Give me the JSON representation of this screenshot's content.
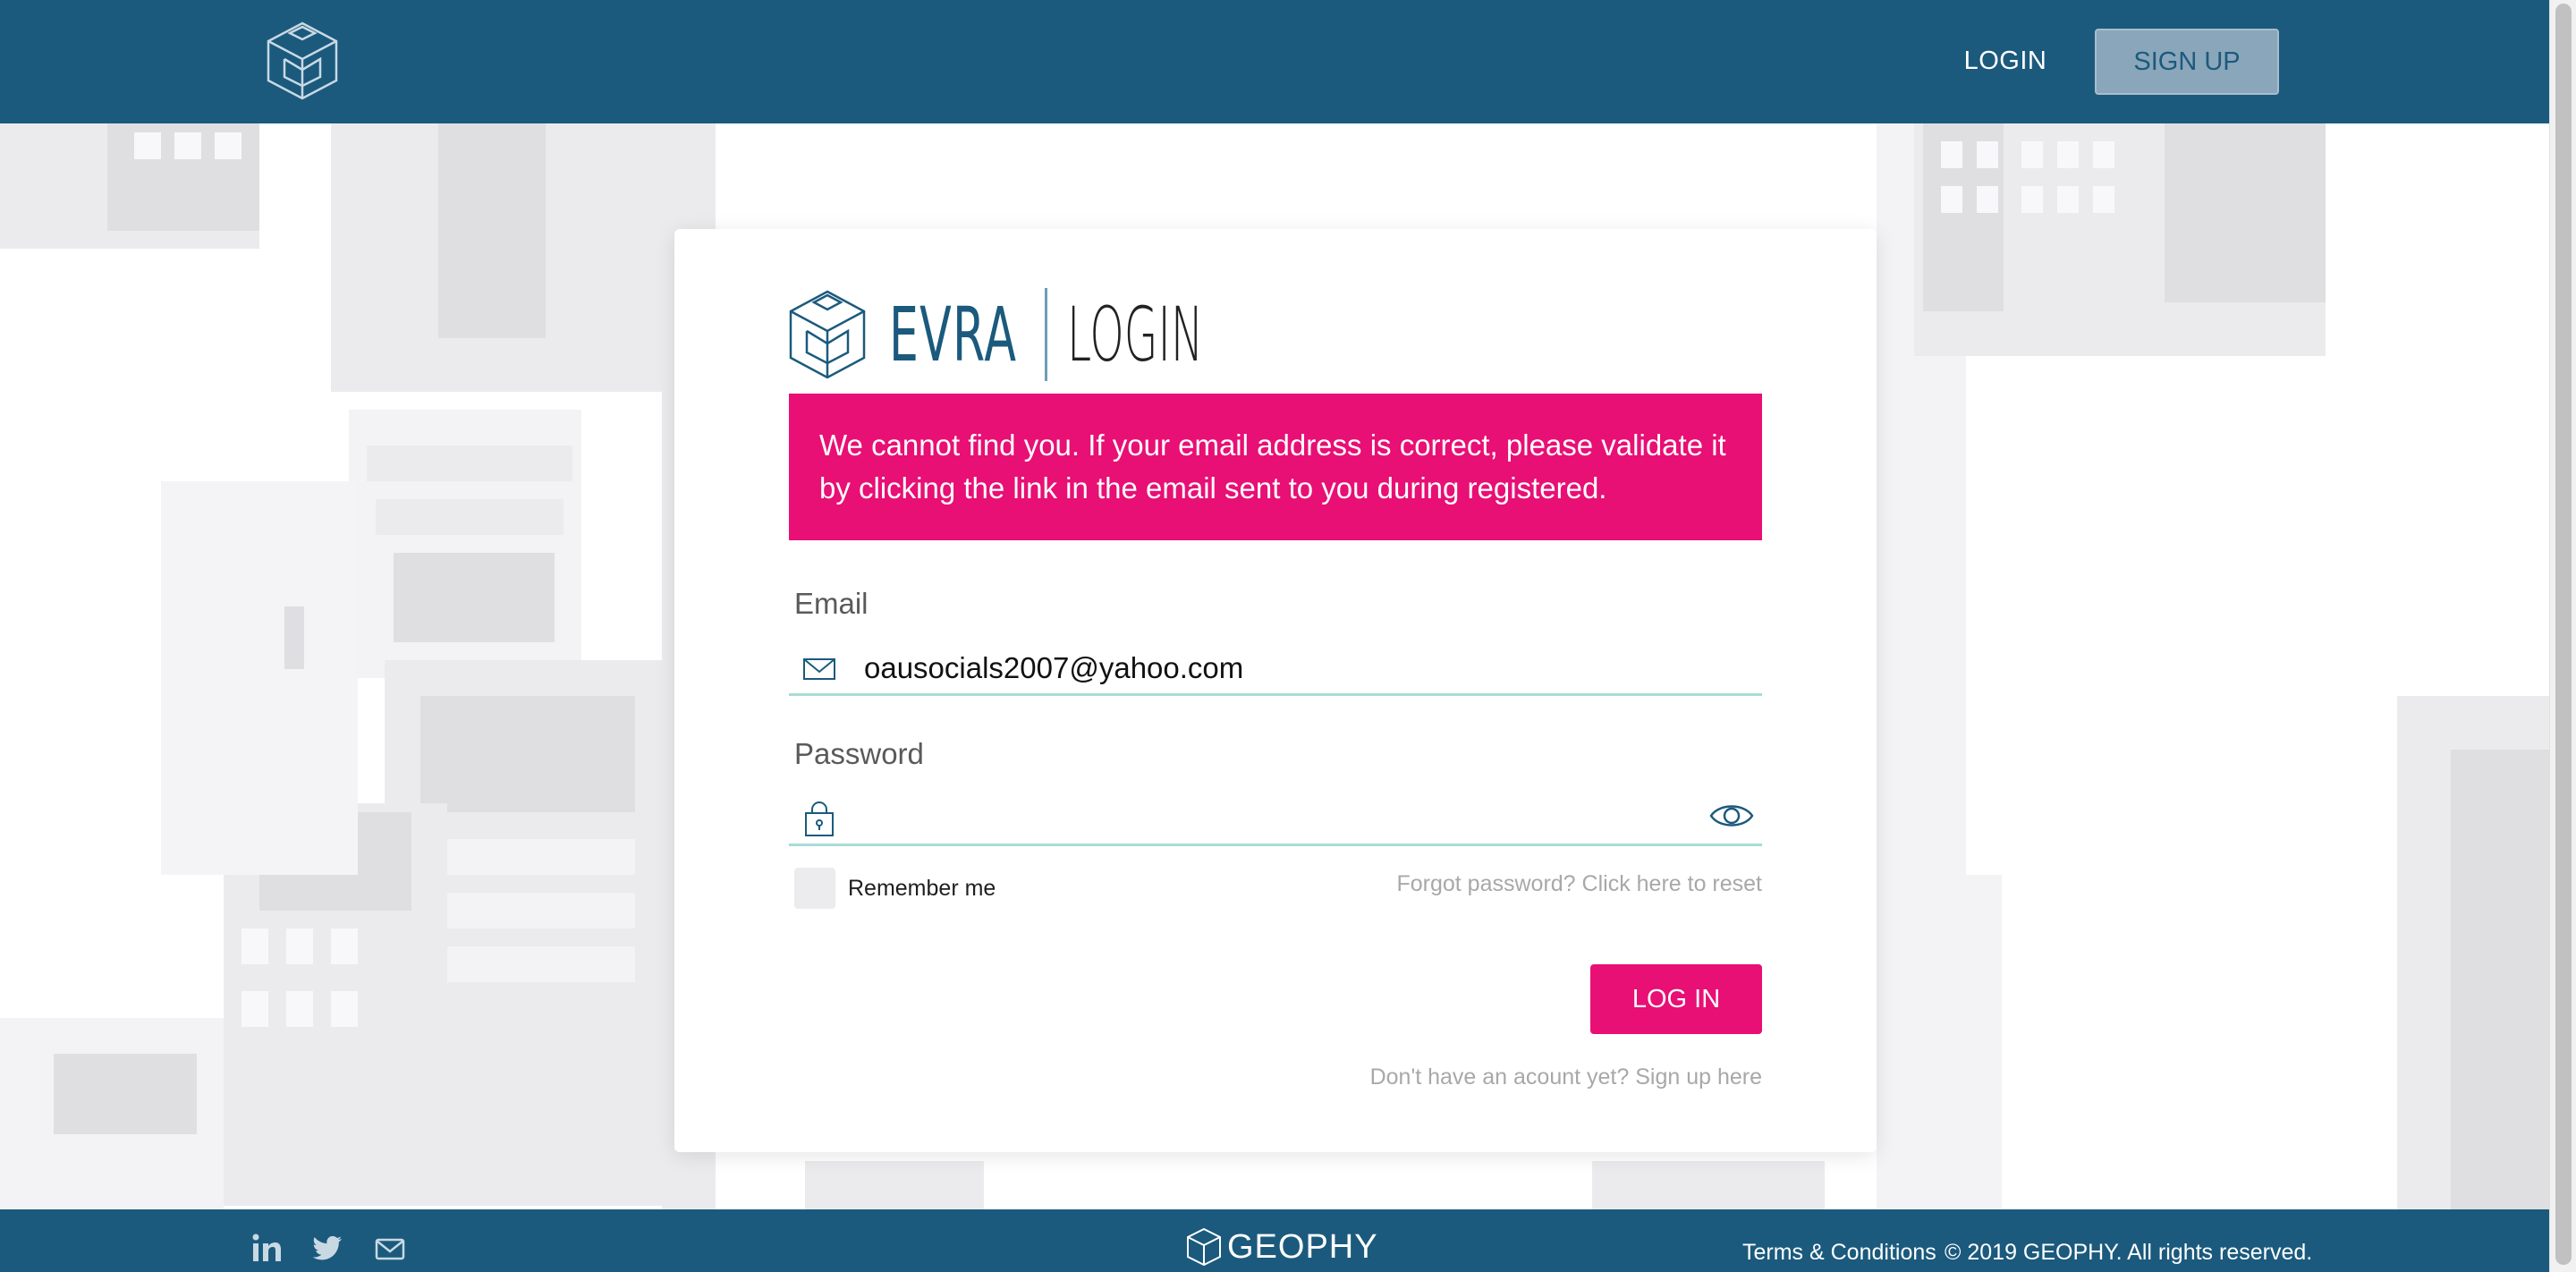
{
  "header": {
    "logo_icon": "cube-logo-icon",
    "nav_login": "LOGIN",
    "nav_signup": "SIGN UP"
  },
  "card": {
    "brand_name": "EVRA",
    "page_title": "LOGIN",
    "alert": "We cannot find you. If your email address is correct, please validate it by clicking the link in the email sent to you during registered.",
    "email": {
      "label": "Email",
      "value": "oausocials2007@yahoo.com",
      "icon": "envelope-icon"
    },
    "password": {
      "label": "Password",
      "value": "",
      "icon": "lock-icon",
      "toggle_icon": "eye-icon"
    },
    "remember_label": "Remember me",
    "forgot_link": "Forgot password? Click here to reset",
    "login_button": "LOG IN",
    "signup_link": "Don't have an acount yet? Sign up here"
  },
  "footer": {
    "social_icons": [
      "linkedin-icon",
      "twitter-icon",
      "mail-icon"
    ],
    "brand": "GEOPHY",
    "terms": "Terms & Conditions",
    "copyright": "© 2019 GEOPHY.  All rights reserved."
  },
  "colors": {
    "primary": "#1b5a7d",
    "accent": "#e80f75",
    "field_underline": "#a8dcd6",
    "signup_button_bg": "#8aa6ba"
  }
}
